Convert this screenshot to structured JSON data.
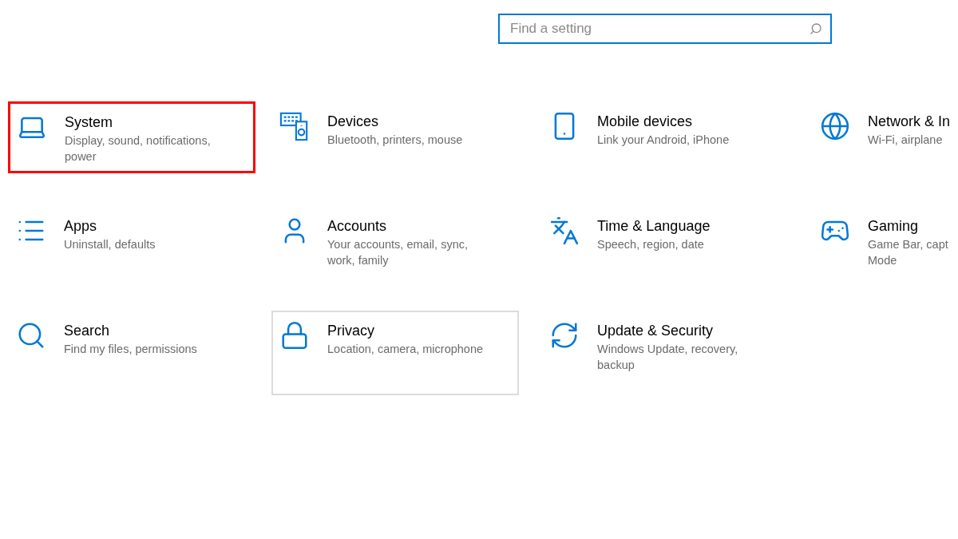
{
  "search": {
    "placeholder": "Find a setting"
  },
  "tiles": [
    {
      "title": "System",
      "subtitle": [
        "Display, sound, notifications,",
        "power"
      ],
      "marked": true,
      "selected": false
    },
    {
      "title": "Devices",
      "subtitle": [
        "Bluetooth, printers, mouse"
      ],
      "marked": false,
      "selected": false
    },
    {
      "title": "Mobile devices",
      "subtitle": [
        "Link your Android, iPhone"
      ],
      "marked": false,
      "selected": false
    },
    {
      "title": "Network & In",
      "subtitle": [
        "Wi-Fi, airplane"
      ],
      "marked": false,
      "selected": false
    },
    {
      "title": "Apps",
      "subtitle": [
        "Uninstall, defaults"
      ],
      "marked": false,
      "selected": false
    },
    {
      "title": "Accounts",
      "subtitle": [
        "Your accounts, email, sync,",
        "work, family"
      ],
      "marked": false,
      "selected": false
    },
    {
      "title": "Time & Language",
      "subtitle": [
        "Speech, region, date"
      ],
      "marked": false,
      "selected": false
    },
    {
      "title": "Gaming",
      "subtitle": [
        "Game Bar, capt",
        "Mode"
      ],
      "marked": false,
      "selected": false
    },
    {
      "title": "Search",
      "subtitle": [
        "Find my files, permissions"
      ],
      "marked": false,
      "selected": false
    },
    {
      "title": "Privacy",
      "subtitle": [
        "Location, camera, microphone"
      ],
      "marked": false,
      "selected": true
    },
    {
      "title": "Update & Security",
      "subtitle": [
        "Windows Update, recovery,",
        "backup"
      ],
      "marked": false,
      "selected": false
    }
  ]
}
